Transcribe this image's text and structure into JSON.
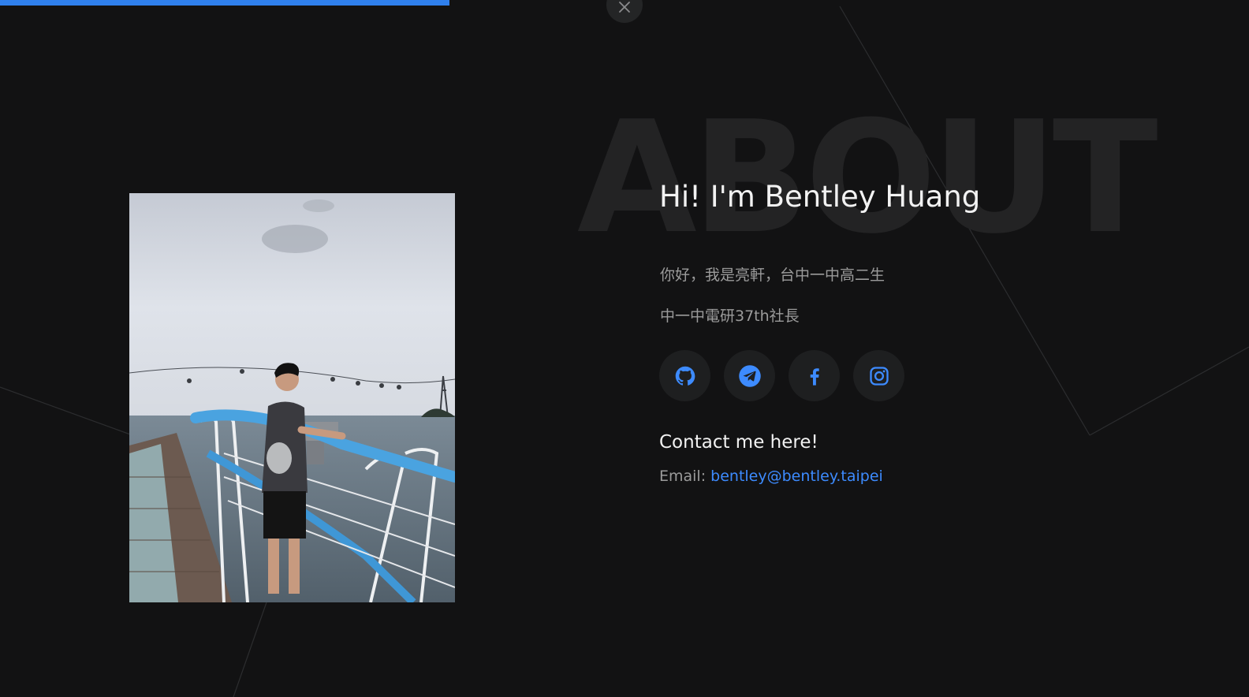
{
  "progress": {
    "fraction": 0.36,
    "color": "#2f80ed"
  },
  "close_icon": "close-icon",
  "background_word": "ABOUT",
  "profile": {
    "greeting": "Hi! I'm Bentley Huang",
    "intro_line_1": "你好，我是亮軒，台中一中高二生",
    "intro_line_2": "中一中電研37th社長"
  },
  "social": [
    {
      "icon": "github-icon"
    },
    {
      "icon": "telegram-icon"
    },
    {
      "icon": "facebook-icon"
    },
    {
      "icon": "instagram-icon"
    }
  ],
  "contact": {
    "title": "Contact me here!",
    "email_label": "Email: ",
    "email": "bentley@bentley.taipei"
  },
  "colors": {
    "background": "#121213",
    "accent": "#3d8bff",
    "button_bg": "#1e1f20",
    "muted_text": "#9b9b9b"
  }
}
